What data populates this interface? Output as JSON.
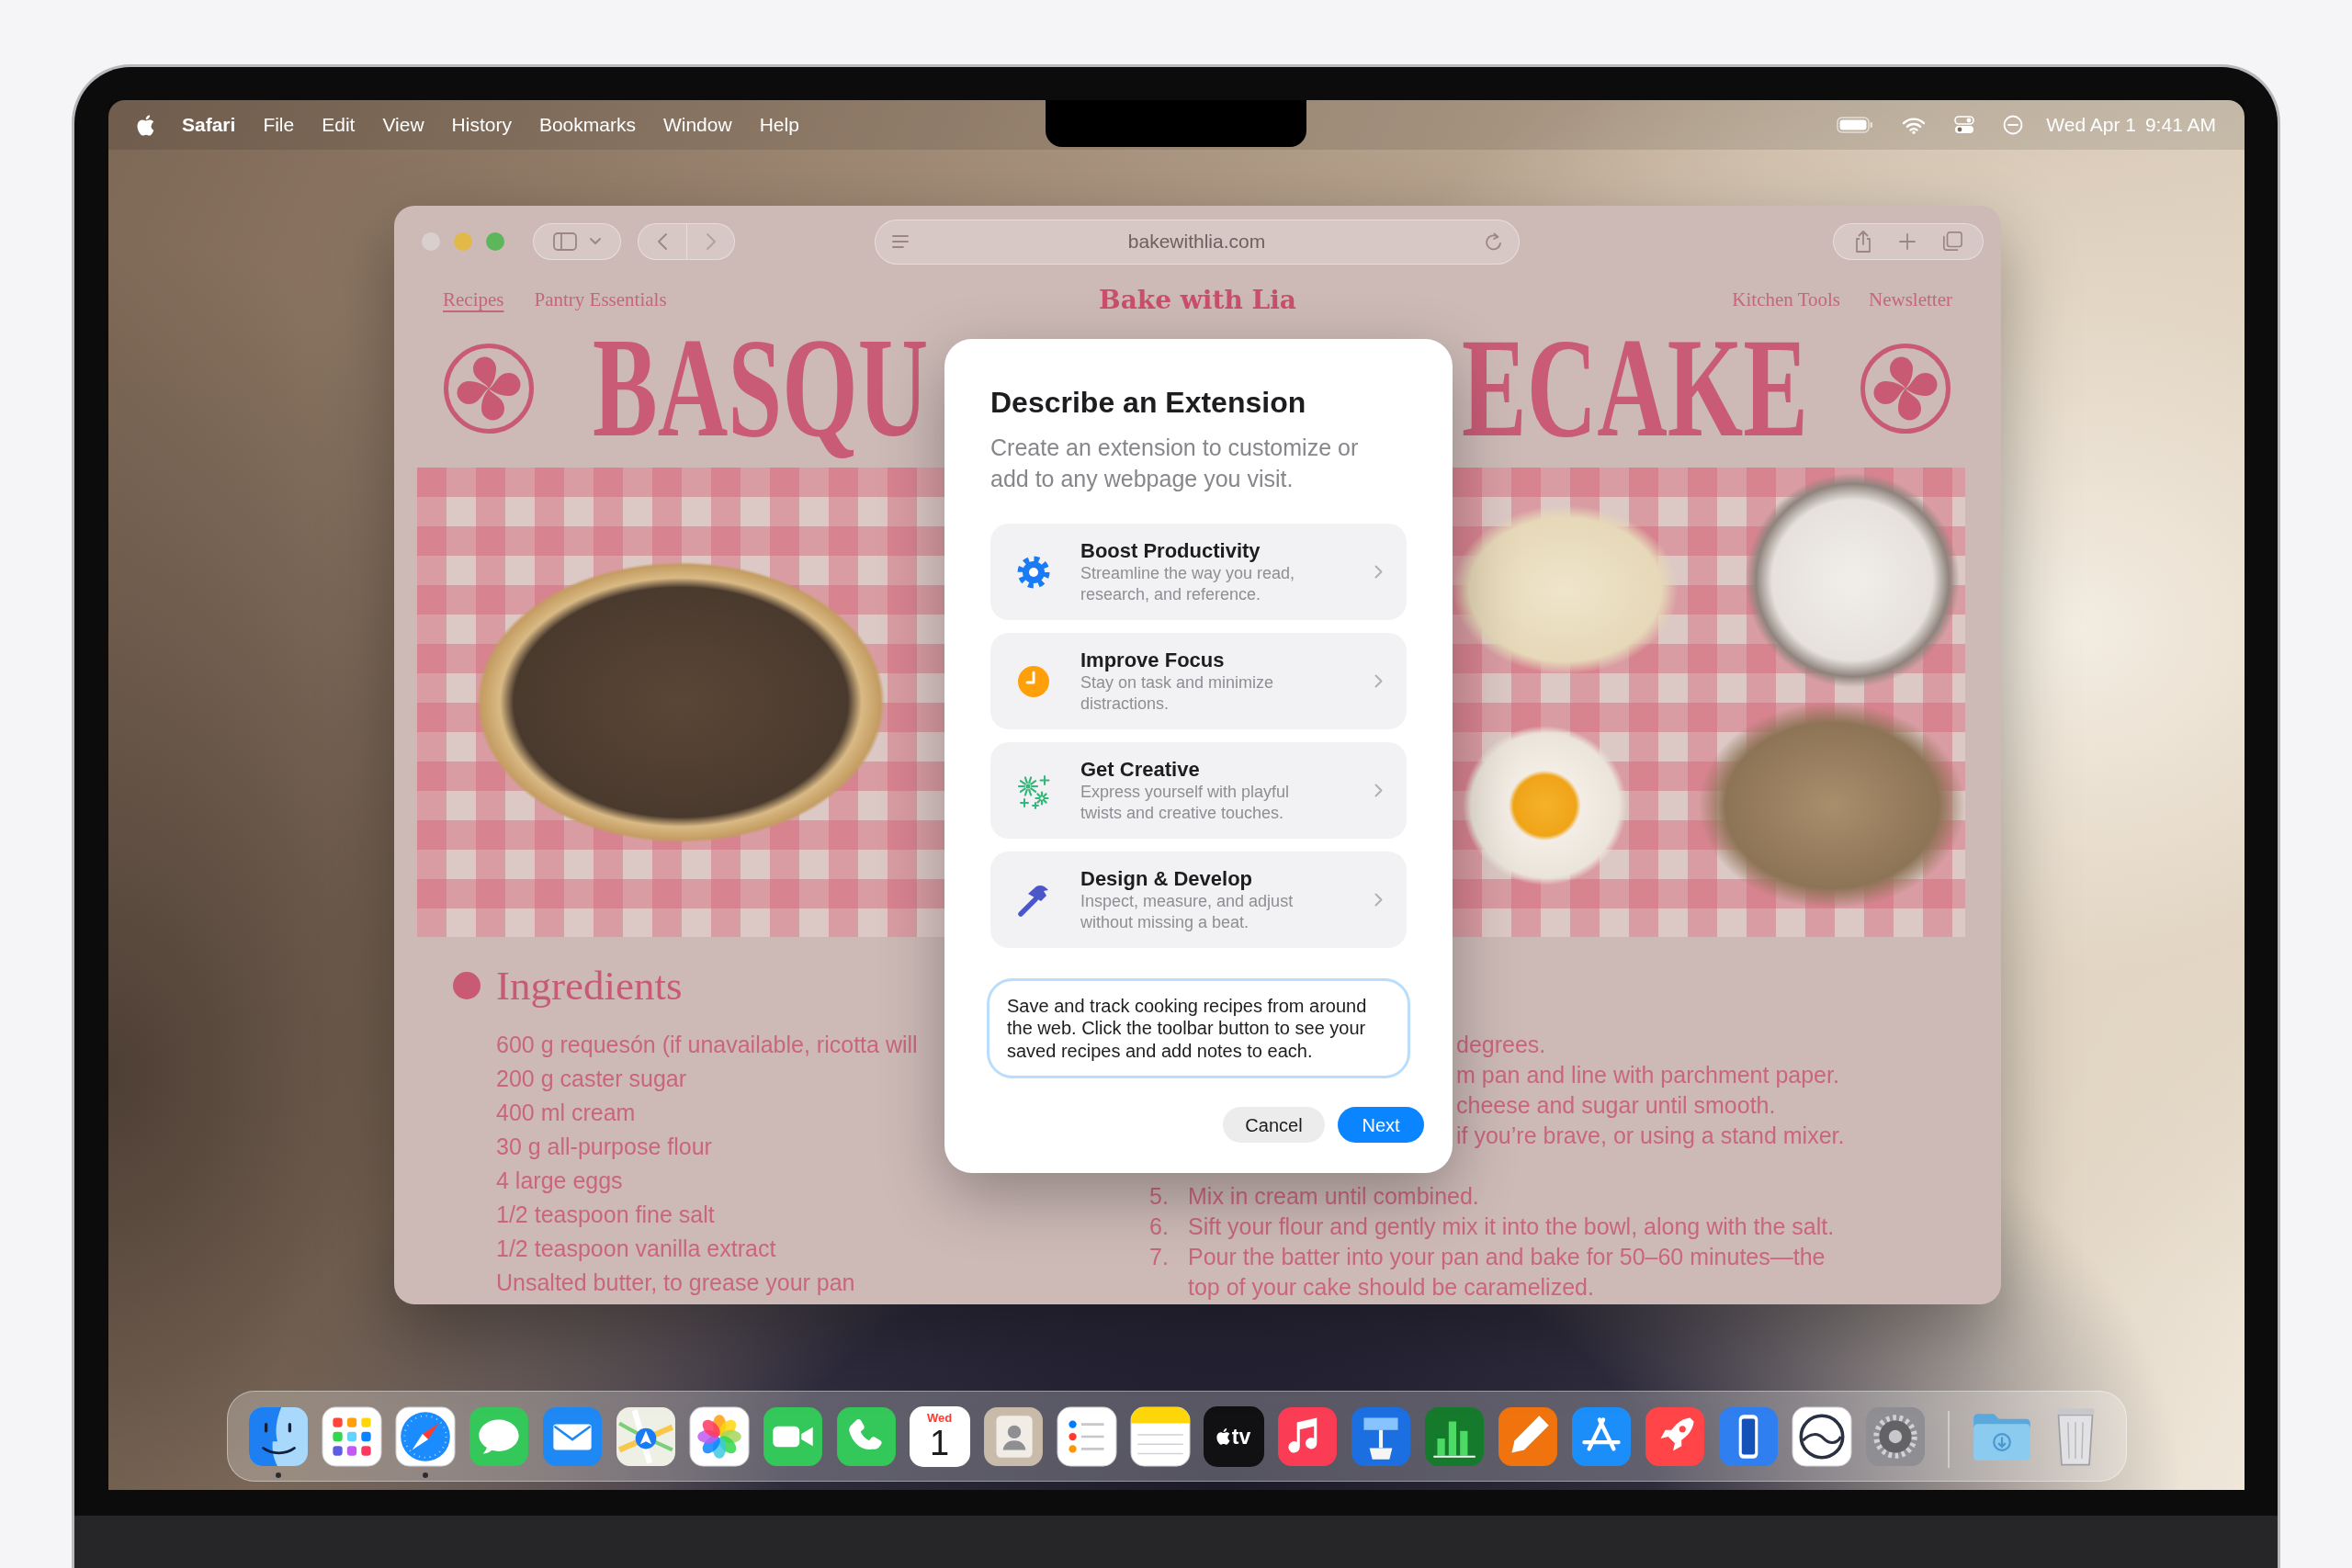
{
  "menu_bar": {
    "app_name": "Safari",
    "menus": [
      "File",
      "Edit",
      "View",
      "History",
      "Bookmarks",
      "Window",
      "Help"
    ],
    "date": "Wed Apr 1",
    "time": "9:41 AM"
  },
  "browser": {
    "address": "bakewithlia.com",
    "page": {
      "nav_left": [
        {
          "label": "Recipes",
          "selected": true
        },
        {
          "label": "Pantry Essentials",
          "selected": false
        }
      ],
      "site_title": "Bake with Lia",
      "nav_right": [
        {
          "label": "Kitchen Tools",
          "selected": false
        },
        {
          "label": "Newsletter",
          "selected": false
        }
      ],
      "title_fragments": [
        "BASQU",
        "ECAKE"
      ],
      "ingredients": {
        "heading": "Ingredients",
        "items": [
          "600 g requesón (if unavailable, ricotta will",
          "200 g caster sugar",
          "400 ml cream",
          "30 g all-purpose flour",
          "4 large eggs",
          "1/2 teaspoon fine salt",
          "1/2 teaspoon vanilla extract",
          "Unsalted butter, to grease your pan"
        ]
      },
      "steps": [
        {
          "kind": "partial",
          "text": "degrees."
        },
        {
          "kind": "partial",
          "text": "m pan and line with parchment paper."
        },
        {
          "kind": "partial",
          "text": "cheese and sugar until smooth."
        },
        {
          "kind": "partial",
          "text": "if you’re brave, or using a stand mixer."
        },
        {
          "kind": "full",
          "number": "5.",
          "text": "Mix in cream until combined."
        },
        {
          "kind": "full",
          "number": "6.",
          "text": "Sift your flour and gently mix it into the bowl, along with the salt."
        },
        {
          "kind": "full",
          "number": "7.",
          "text": "Pour the batter into your pan and bake for 50–60 minutes—the top of your cake should be caramelized."
        }
      ]
    }
  },
  "dialog": {
    "title": "Describe an Extension",
    "subtitle": "Create an extension to customize or add to any webpage you visit.",
    "options": [
      {
        "kind": "gear",
        "title": "Boost Productivity",
        "description": "Streamline the way you read, research, and reference."
      },
      {
        "kind": "clock",
        "title": "Improve Focus",
        "description": "Stay on task and minimize distractions."
      },
      {
        "kind": "sparkles",
        "title": "Get Creative",
        "description": "Express yourself with playful twists and creative touches."
      },
      {
        "kind": "hammer",
        "title": "Design & Develop",
        "description": "Inspect, measure, and adjust without missing a beat."
      }
    ],
    "description_field": {
      "value": "Save and track cooking recipes from around the web. Click the toolbar button to see your saved recipes and add notes to each."
    },
    "buttons": [
      {
        "kind": "secondary",
        "label": "Cancel"
      },
      {
        "kind": "primary",
        "label": "Next"
      }
    ]
  },
  "dock": {
    "apps": [
      {
        "kind": "face",
        "running": true
      },
      {
        "kind": "grid",
        "running": false
      },
      {
        "kind": "compass",
        "running": true
      },
      {
        "kind": "bubble",
        "running": false
      },
      {
        "kind": "envelope",
        "running": false
      },
      {
        "kind": "map",
        "running": false
      },
      {
        "kind": "flower",
        "running": false
      },
      {
        "kind": "camera",
        "running": false
      },
      {
        "kind": "phone",
        "running": false
      },
      {
        "kind": "calendar",
        "running": false,
        "weekday": "Wed",
        "day": "1"
      },
      {
        "kind": "contacts",
        "running": false
      },
      {
        "kind": "checklist",
        "running": false
      },
      {
        "kind": "notepad",
        "running": false
      },
      {
        "kind": "tv",
        "running": false,
        "label": "tv"
      },
      {
        "kind": "music",
        "running": false
      },
      {
        "kind": "podium",
        "running": false
      },
      {
        "kind": "chart",
        "running": false
      },
      {
        "kind": "pencil",
        "running": false
      },
      {
        "kind": "appstore",
        "running": false
      },
      {
        "kind": "rocket",
        "running": false
      },
      {
        "kind": "device",
        "running": false
      },
      {
        "kind": "swirl",
        "running": false
      },
      {
        "kind": "gear",
        "running": false
      }
    ],
    "stacks": [
      {
        "kind": "folder",
        "running": false
      },
      {
        "kind": "trash",
        "running": false
      }
    ]
  }
}
